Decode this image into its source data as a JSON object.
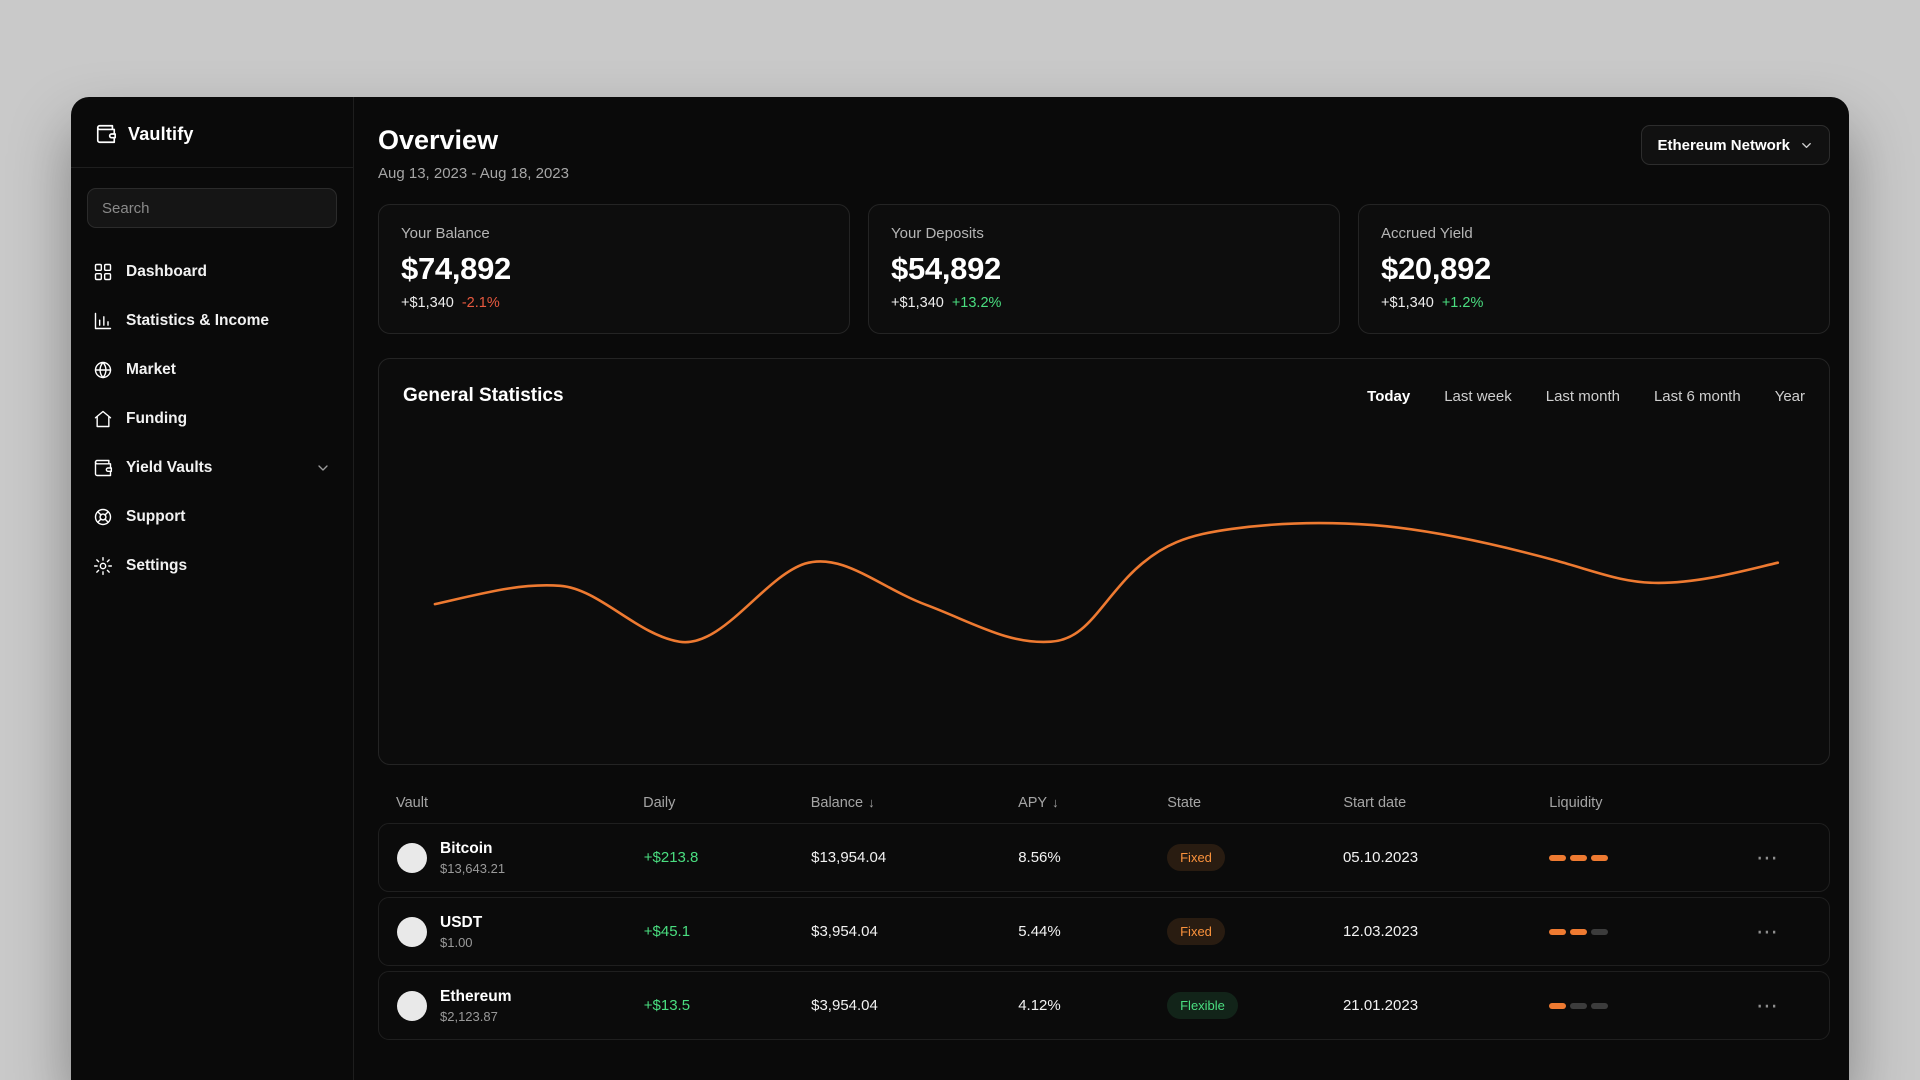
{
  "app": {
    "name": "Vaultify"
  },
  "sidebar": {
    "search_placeholder": "Search",
    "items": [
      {
        "label": "Dashboard",
        "icon": "grid-icon"
      },
      {
        "label": "Statistics & Income",
        "icon": "bar-chart-icon"
      },
      {
        "label": "Market",
        "icon": "globe-icon"
      },
      {
        "label": "Funding",
        "icon": "home-icon"
      },
      {
        "label": "Yield Vaults",
        "icon": "wallet-icon",
        "has_submenu": true
      },
      {
        "label": "Support",
        "icon": "life-buoy-icon"
      },
      {
        "label": "Settings",
        "icon": "gear-icon"
      }
    ]
  },
  "header": {
    "title": "Overview",
    "date_range": "Aug 13, 2023 - Aug 18, 2023",
    "network_selector": "Ethereum Network"
  },
  "stats": [
    {
      "label": "Your Balance",
      "value": "$74,892",
      "change_amount": "+$1,340",
      "change_pct": "-2.1%",
      "trend": "down"
    },
    {
      "label": "Your Deposits",
      "value": "$54,892",
      "change_amount": "+$1,340",
      "change_pct": "+13.2%",
      "trend": "up"
    },
    {
      "label": "Accrued Yield",
      "value": "$20,892",
      "change_amount": "+$1,340",
      "change_pct": "+1.2%",
      "trend": "up"
    }
  ],
  "chart_section": {
    "title": "General Statistics",
    "ranges": [
      "Today",
      "Last week",
      "Last month",
      "Last 6 month",
      "Year"
    ],
    "active_range": "Today",
    "line_color": "#ee7a31",
    "line_path": "M27 190 C70 178 100 168 133 171 C166 174 198 222 234 229 C270 236 305 162 340 148 C372 136 402 172 443 191 C482 209 512 232 548 229 C576 227 587 196 613 162 C641 126 666 118 701 112 C736 106 776 104 821 108 C871 113 931 130 976 145 C1011 157 1032 168 1062 168 C1097 168 1132 156 1163 147"
  },
  "table": {
    "headers": [
      "Vault",
      "Daily",
      "Balance",
      "APY",
      "State",
      "Start date",
      "Liquidity"
    ],
    "sort_arrow": "↓",
    "menu_glyph": "⋯",
    "rows": [
      {
        "name": "Bitcoin",
        "price": "$13,643.21",
        "daily": "+$213.8",
        "balance": "$13,954.04",
        "apy": "8.56%",
        "state": "Fixed",
        "state_type": "fixed",
        "start_date": "05.10.2023",
        "liquidity": 3
      },
      {
        "name": "USDT",
        "price": "$1.00",
        "daily": "+$45.1",
        "balance": "$3,954.04",
        "apy": "5.44%",
        "state": "Fixed",
        "state_type": "fixed",
        "start_date": "12.03.2023",
        "liquidity": 2
      },
      {
        "name": "Ethereum",
        "price": "$2,123.87",
        "daily": "+$13.5",
        "balance": "$3,954.04",
        "apy": "4.12%",
        "state": "Flexible",
        "state_type": "flexible",
        "start_date": "21.01.2023",
        "liquidity": 1
      }
    ]
  },
  "colors": {
    "positive": "#4ade80",
    "negative": "#e8593f",
    "accent_orange": "#ee7a31",
    "pill_fixed": "#fb923c",
    "pill_flexible": "#4ade80",
    "app_background": "#0a0a0a",
    "desktop_background": "#c9c9c9"
  }
}
